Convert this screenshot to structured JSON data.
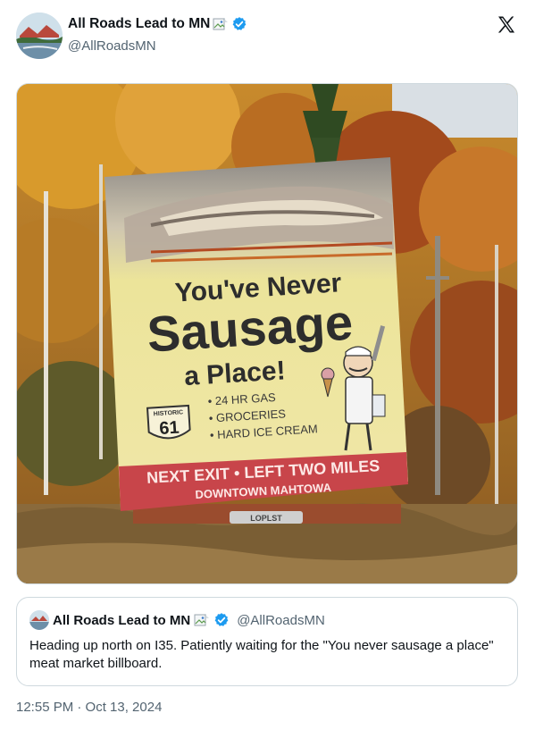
{
  "tweet": {
    "display_name": "All Roads Lead to MN",
    "handle": "@AllRoadsMN",
    "timestamp": "12:55 PM · Oct 13, 2024"
  },
  "billboard": {
    "line1": "You've Never",
    "line2": "Sausage",
    "line3": "a Place!",
    "shield_top": "HISTORIC",
    "shield_num": "61",
    "amenities": [
      "• 24 HR GAS",
      "• GROCERIES",
      "• HARD ICE CREAM"
    ],
    "band_line1": "NEXT EXIT • LEFT TWO MILES",
    "band_line2": "DOWNTOWN MAHTOWA",
    "base_sign": "LOPLST"
  },
  "quoted_tweet": {
    "display_name": "All Roads Lead to MN",
    "handle": "@AllRoadsMN",
    "text": "Heading up north on I35. Patiently waiting for the \"You never sausage a place\" meat market billboard."
  },
  "colors": {
    "verified_blue": "#1d9bf0",
    "muted_text": "#536471",
    "border": "#cfd9de"
  },
  "icons": [
    "verified-badge-icon",
    "x-logo-icon",
    "broken-image-icon"
  ]
}
